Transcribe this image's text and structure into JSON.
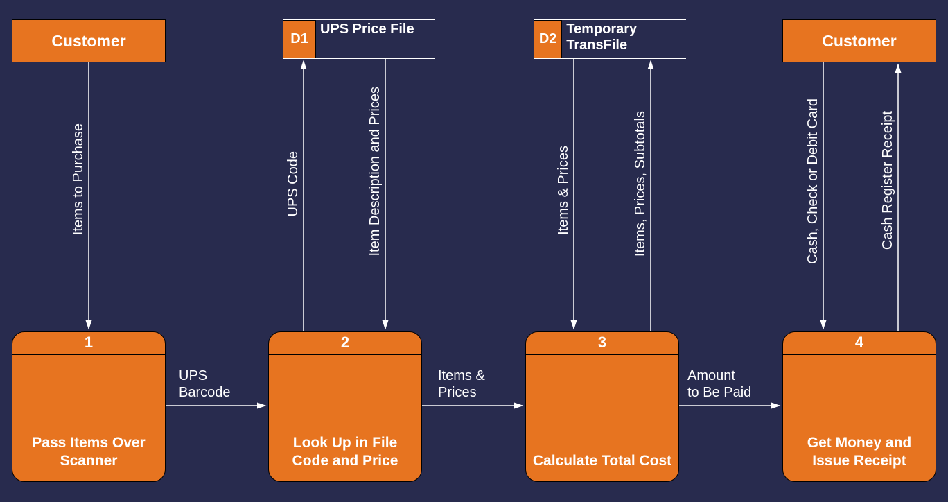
{
  "entities": {
    "customerLeft": "Customer",
    "customerRight": "Customer"
  },
  "datastores": {
    "d1": {
      "id": "D1",
      "label": "UPS Price\nFile"
    },
    "d2": {
      "id": "D2",
      "label": "Temporary\nTransFile"
    }
  },
  "processes": {
    "p1": {
      "id": "1",
      "label": "Pass Items Over\nScanner"
    },
    "p2": {
      "id": "2",
      "label": "Look Up in File\nCode and Price"
    },
    "p3": {
      "id": "3",
      "label": "Calculate Total\nCost"
    },
    "p4": {
      "id": "4",
      "label": "Get Money and\nIssue Receipt"
    }
  },
  "flows": {
    "itemsToPurchase": "Items to Purchase",
    "upsCode": "UPS Code",
    "itemDescPrices": "Item Description and Prices",
    "itemsPrices_v": "Items & Prices",
    "itemsPricesSubtotals": "Items, Prices, Subtotals",
    "cashCheckDebit": "Cash, Check or Debit Card",
    "cashRegisterReceipt": "Cash Register Receipt",
    "upsBarcode": "UPS\nBarcode",
    "itemsPrices_h": "Items &\nPrices",
    "amountToBePaid": "Amount\nto Be Paid"
  }
}
